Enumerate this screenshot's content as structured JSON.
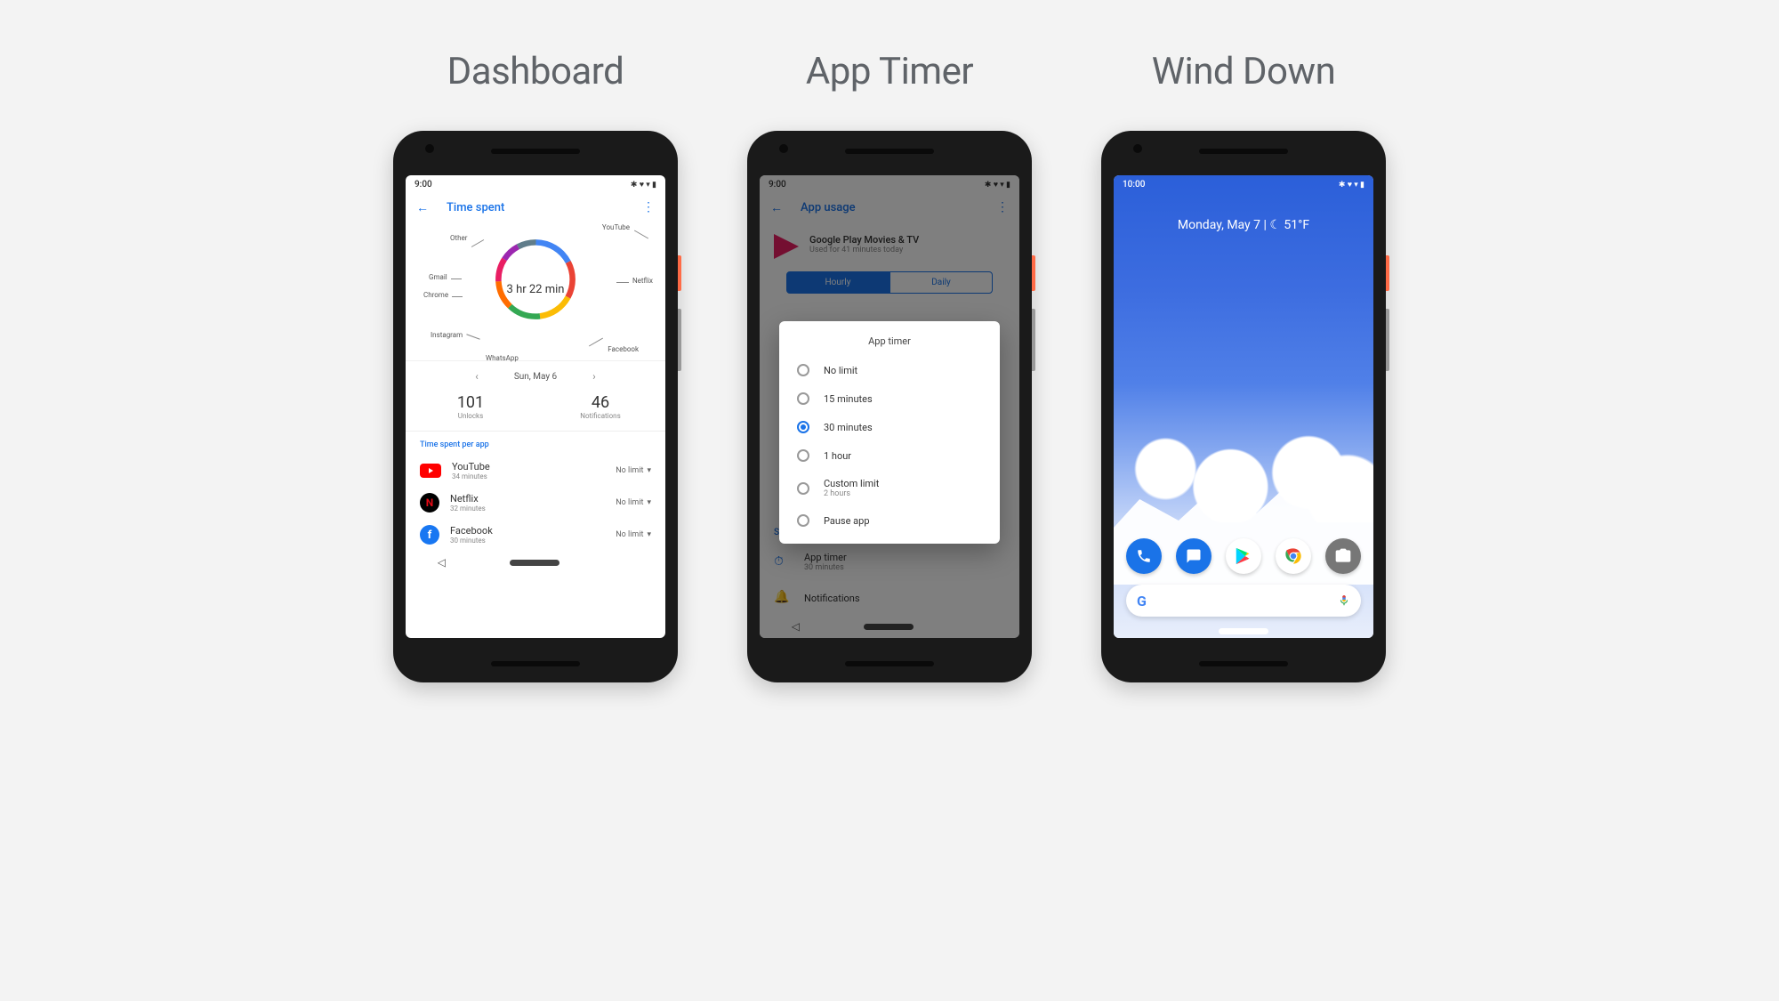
{
  "titles": [
    "Dashboard",
    "App Timer",
    "Wind Down"
  ],
  "phone1": {
    "status_time": "9:00",
    "app_title": "Time spent",
    "donut": {
      "total": "3 hr 22 min",
      "segments": [
        {
          "label": "YouTube"
        },
        {
          "label": "Netflix"
        },
        {
          "label": "Facebook"
        },
        {
          "label": "WhatsApp"
        },
        {
          "label": "Instagram"
        },
        {
          "label": "Chrome"
        },
        {
          "label": "Gmail"
        },
        {
          "label": "Other"
        }
      ]
    },
    "date_label": "Sun, May 6",
    "unlocks": {
      "value": "101",
      "label": "Unlocks"
    },
    "notifications": {
      "value": "46",
      "label": "Notifications"
    },
    "section_header": "Time spent per app",
    "apps": [
      {
        "name": "YouTube",
        "time": "34 minutes",
        "limit": "No limit"
      },
      {
        "name": "Netflix",
        "time": "32 minutes",
        "limit": "No limit"
      },
      {
        "name": "Facebook",
        "time": "30 minutes",
        "limit": "No limit"
      }
    ]
  },
  "phone2": {
    "status_time": "9:00",
    "app_title": "App usage",
    "header_app": "Google Play Movies & TV",
    "header_sub": "Used for 41 minutes today",
    "seg_hourly": "Hourly",
    "seg_daily": "Daily",
    "settings_header": "Settings",
    "setting_timer": {
      "title": "App timer",
      "sub": "30 minutes"
    },
    "setting_notif": {
      "title": "Notifications"
    },
    "dialog_title": "App timer",
    "options": [
      {
        "label": "No limit",
        "checked": false
      },
      {
        "label": "15 minutes",
        "checked": false
      },
      {
        "label": "30 minutes",
        "checked": true
      },
      {
        "label": "1 hour",
        "checked": false
      },
      {
        "label": "Custom limit",
        "sub": "2 hours",
        "checked": false
      },
      {
        "label": "Pause app",
        "checked": false
      }
    ]
  },
  "phone3": {
    "status_time": "10:00",
    "date_weather": "Monday, May 7 | ☾ 51°F"
  }
}
